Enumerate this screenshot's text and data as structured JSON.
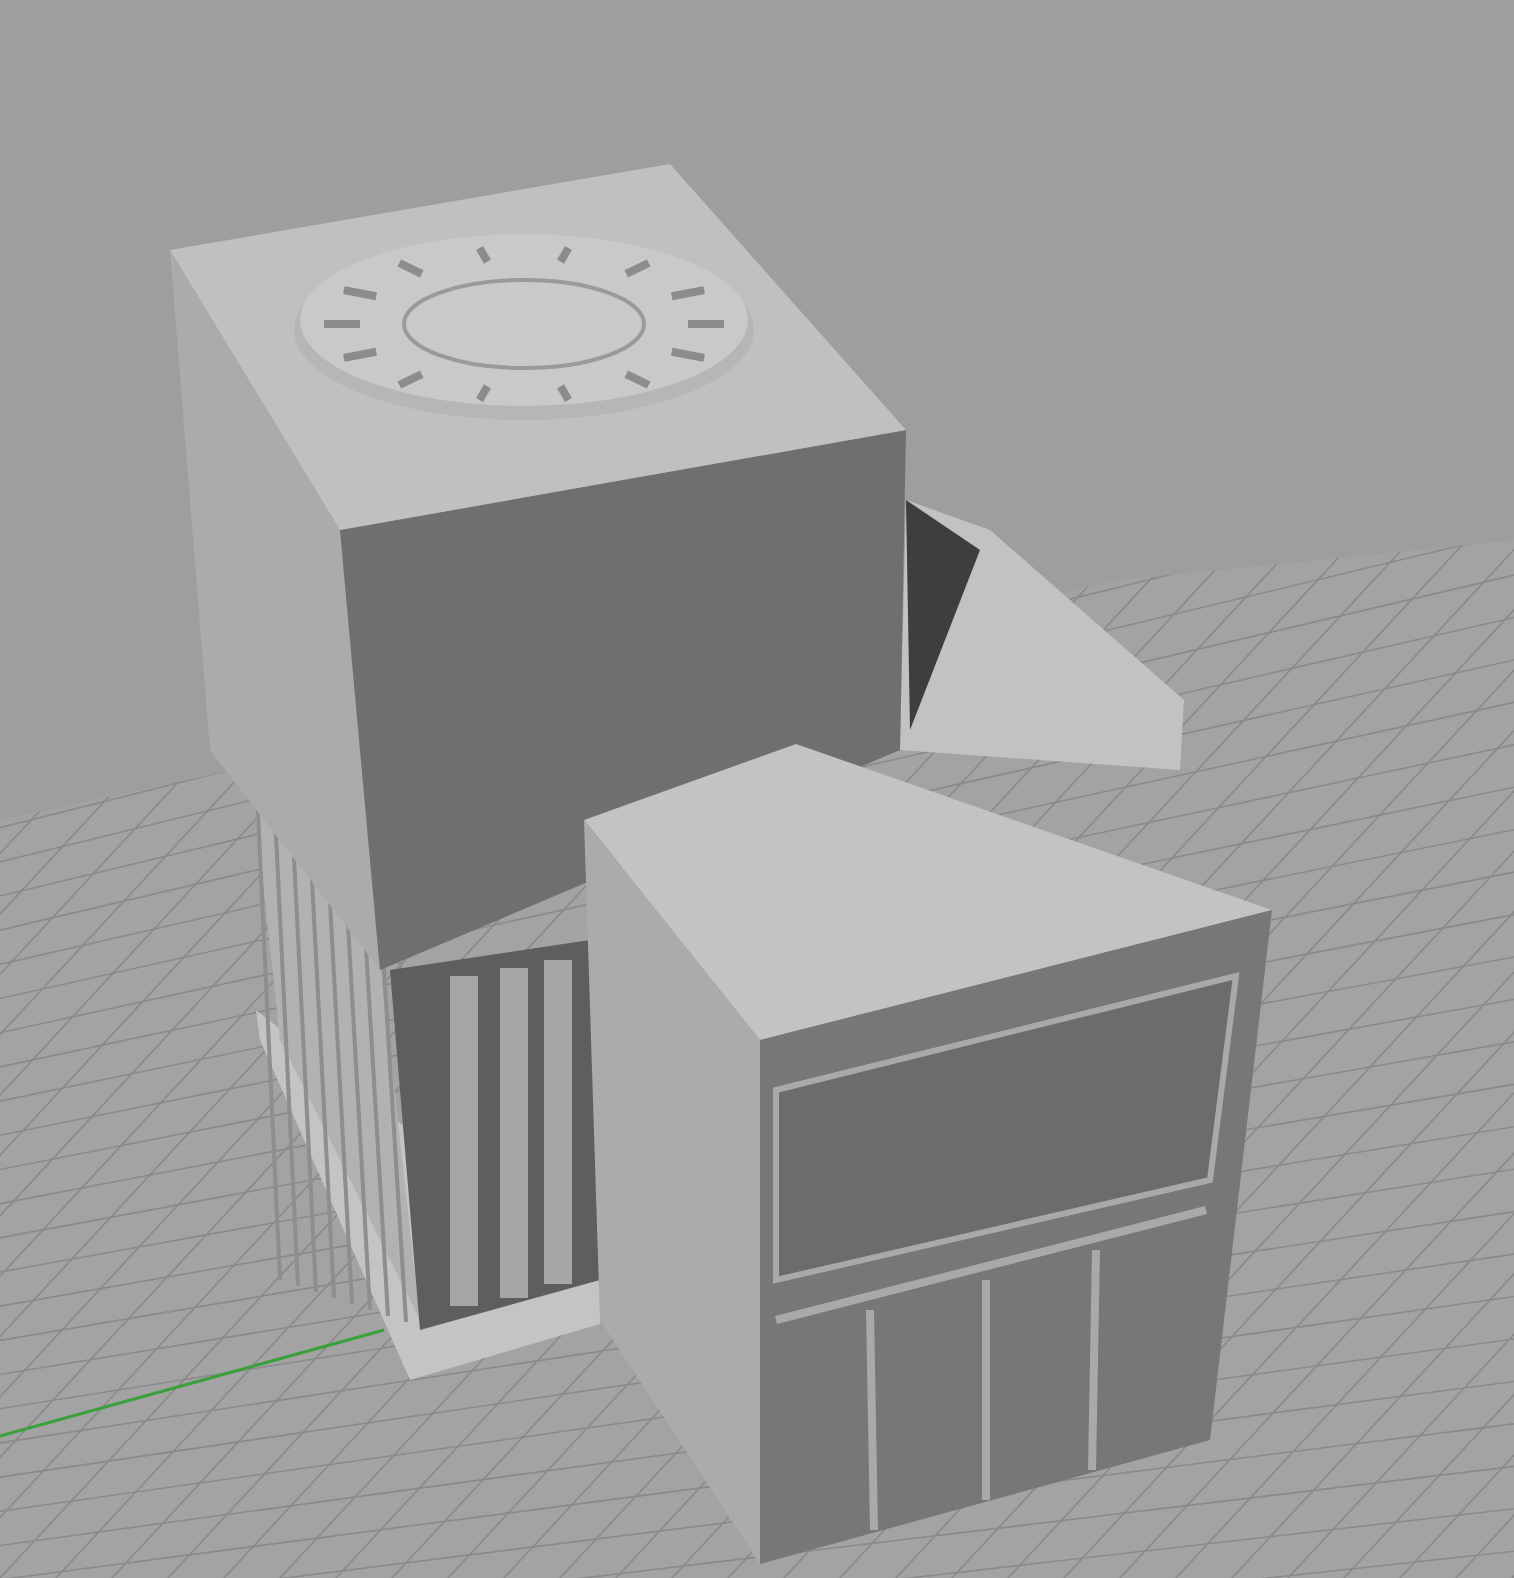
{
  "viewport": {
    "grid_visible": true,
    "axis_visible": true
  }
}
